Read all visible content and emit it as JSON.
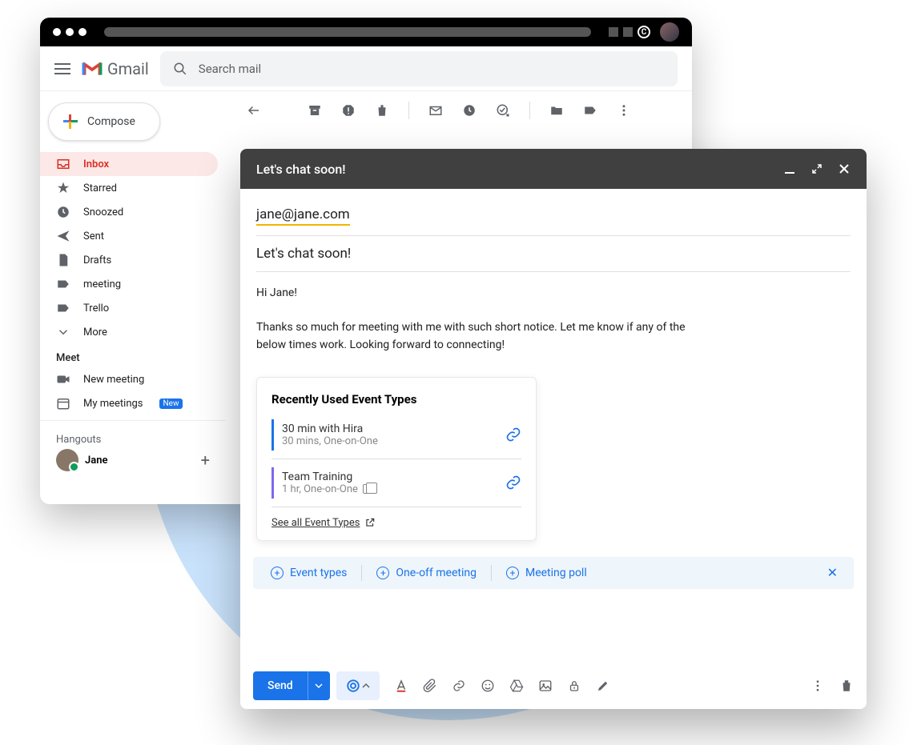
{
  "app": {
    "name": "Gmail"
  },
  "search": {
    "placeholder": "Search mail"
  },
  "compose_btn": "Compose",
  "sidebar": {
    "items": [
      {
        "label": "Inbox"
      },
      {
        "label": "Starred"
      },
      {
        "label": "Snoozed"
      },
      {
        "label": "Sent"
      },
      {
        "label": "Drafts"
      },
      {
        "label": "meeting"
      },
      {
        "label": "Trello"
      },
      {
        "label": "More"
      }
    ],
    "meet_header": "Meet",
    "meet_items": [
      {
        "label": "New meeting"
      },
      {
        "label": "My meetings",
        "badge": "New"
      }
    ],
    "hangouts_header": "Hangouts",
    "hangouts_user": "Jane"
  },
  "compose": {
    "title": "Let's chat soon!",
    "to": "jane@jane.com",
    "subject": "Let's chat soon!",
    "body_greeting": "Hi Jane!",
    "body_text": "Thanks so much for meeting with me with such short notice. Let me know if any of the below times work. Looking forward to connecting!"
  },
  "calendly": {
    "title": "Recently Used Event Types",
    "events": [
      {
        "name": "30 min with Hira",
        "meta": "30 mins, One-on-One"
      },
      {
        "name": "Team Training",
        "meta": "1 hr, One-on-One"
      }
    ],
    "see_all": "See all Event Types"
  },
  "chips": {
    "event_types": "Event types",
    "one_off": "One-off meeting",
    "poll": "Meeting poll"
  },
  "send": "Send"
}
